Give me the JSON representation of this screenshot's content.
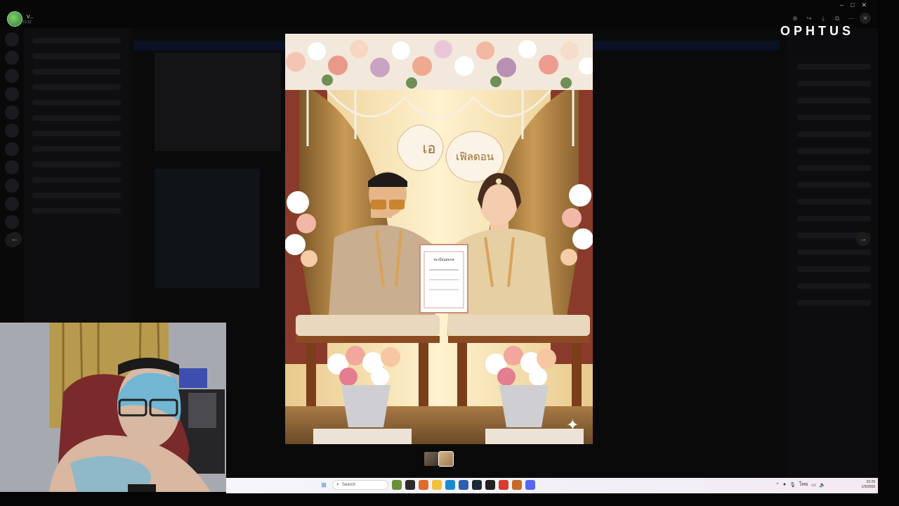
{
  "user": {
    "name": "V...",
    "time": "21:12"
  },
  "brand": {
    "logo_text": "OPHTUS"
  },
  "toolbar": {
    "icons": [
      "zoom-in-icon",
      "forward-icon",
      "download-icon",
      "open-external-icon",
      "more-icon",
      "close-icon"
    ],
    "glyphs": {
      "zoom": "⊕",
      "forward": "↪",
      "download": "⤓",
      "external": "⧉",
      "more": "⋯",
      "close": "✕"
    }
  },
  "window_controls": {
    "minimize": "–",
    "maximize": "□",
    "close": "✕"
  },
  "nav": {
    "prev_glyph": "←",
    "next_glyph": "→"
  },
  "photo": {
    "sign_left": "เอ",
    "sign_right": "เฟิลดอน",
    "certificate_title": "ทะเบียนสมรส"
  },
  "taskbar": {
    "search_placeholder": "Search",
    "tray": {
      "up_arrow": "⌃",
      "lang": "ไทย"
    },
    "clock_time": "22:29",
    "clock_date": "1/9/2569"
  },
  "colors": {
    "accent": "#7ed36a",
    "backdrop": "#050505"
  }
}
